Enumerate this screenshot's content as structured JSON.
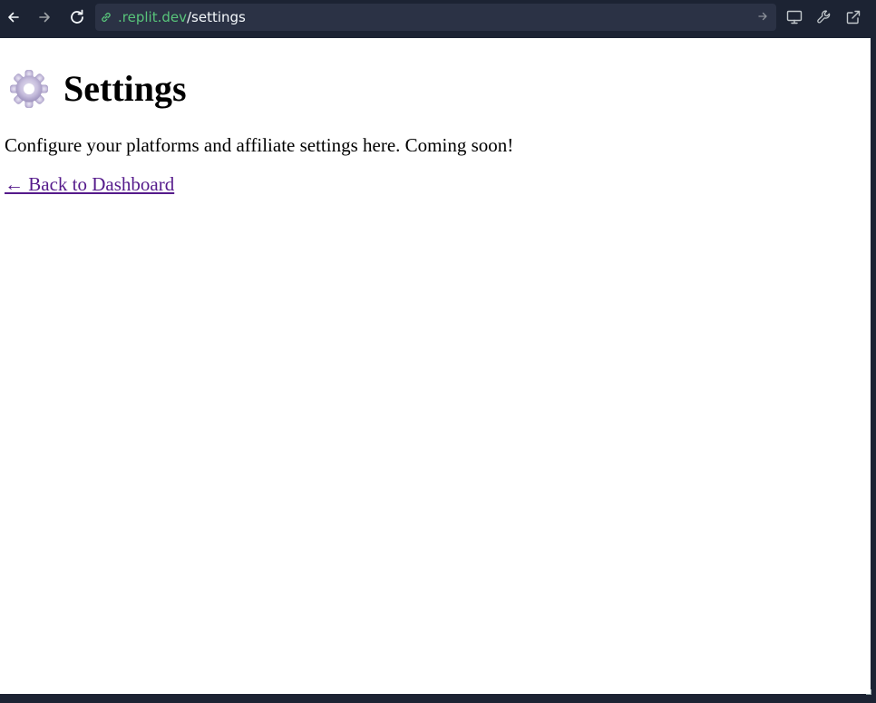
{
  "browser": {
    "url_domain": ".replit.dev",
    "url_path": "/settings",
    "icons": {
      "back": "arrow-left-icon",
      "forward": "arrow-right-icon",
      "reload": "reload-icon",
      "link": "link-icon",
      "go": "arrow-right-icon",
      "devices": "monitor-icon",
      "devtools": "wrench-icon",
      "open_new_tab": "external-link-icon"
    },
    "colors": {
      "chrome_bg": "#1c2333",
      "url_bar_bg": "#2b3245",
      "url_domain": "#58c47a",
      "url_path": "#f5f9fc"
    }
  },
  "page": {
    "heading_icon": "gear-icon",
    "title": "Settings",
    "description": "Configure your platforms and affiliate settings here. Coming soon!",
    "back_link": "← Back to Dashboard",
    "colors": {
      "background": "#ffffff",
      "text": "#000000",
      "link_visited": "#551a8b"
    }
  }
}
